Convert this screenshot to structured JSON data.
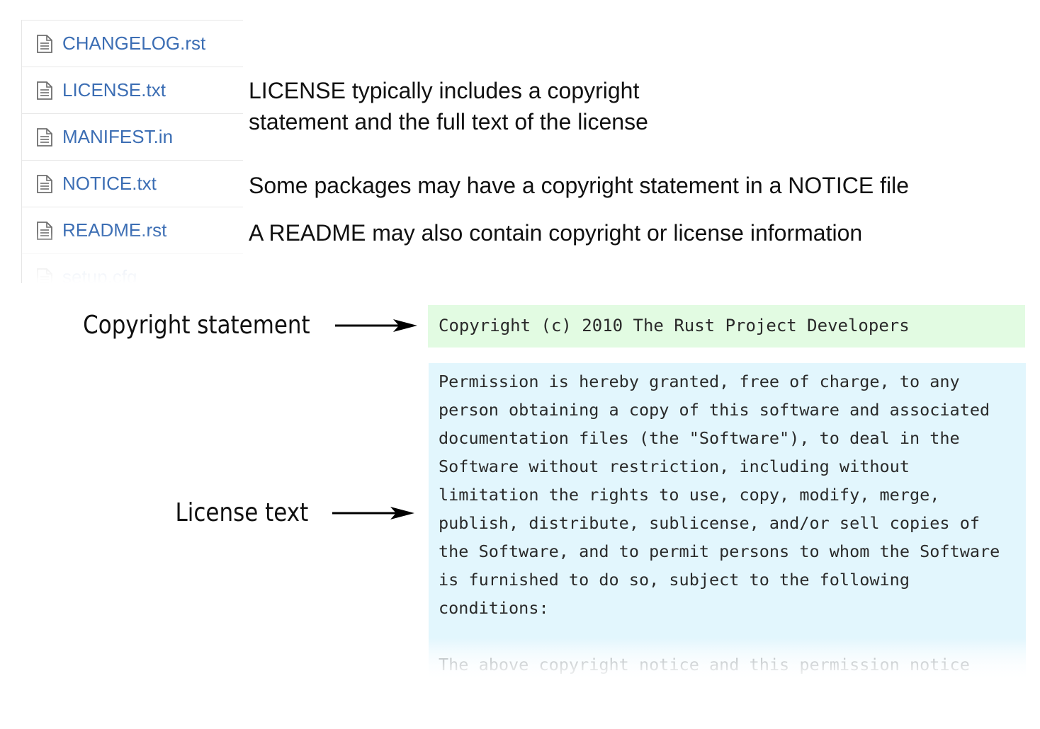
{
  "file_list": {
    "files": [
      {
        "name": "CHANGELOG.rst",
        "icon": "file-text-icon"
      },
      {
        "name": "LICENSE.txt",
        "icon": "file-text-icon"
      },
      {
        "name": "MANIFEST.in",
        "icon": "file-text-icon"
      },
      {
        "name": "NOTICE.txt",
        "icon": "file-text-icon"
      },
      {
        "name": "README.rst",
        "icon": "file-text-icon"
      },
      {
        "name": "setup.cfg",
        "icon": "file-text-icon"
      }
    ],
    "link_color": "#3c6eb4"
  },
  "annotations": {
    "license_line1": "LICENSE typically includes a copyright",
    "license_line2": "statement and the full text of the license",
    "notice": "Some packages may have a copyright statement in a NOTICE file",
    "readme": "A README may also contain copyright or license information"
  },
  "callouts": {
    "copyright_label": "Copyright statement",
    "license_label": "License text",
    "arrow_icon": "right-arrow-icon"
  },
  "copyright_box": {
    "text": "Copyright (c) 2010 The Rust Project Developers",
    "background": "#e2fbe2"
  },
  "license_box": {
    "lines": [
      "Permission is hereby granted, free of charge, to any",
      "person obtaining a copy of this software and associated",
      "documentation files (the \"Software\"), to deal in the",
      "Software without restriction, including without",
      "limitation the rights to use, copy, modify, merge,",
      "publish, distribute, sublicense, and/or sell copies of",
      "the Software, and to permit persons to whom the Software",
      "is furnished to do so, subject to the following",
      "conditions:"
    ],
    "faded_line": "The above copyright notice and this permission notice",
    "background": "#e2f6fd"
  }
}
